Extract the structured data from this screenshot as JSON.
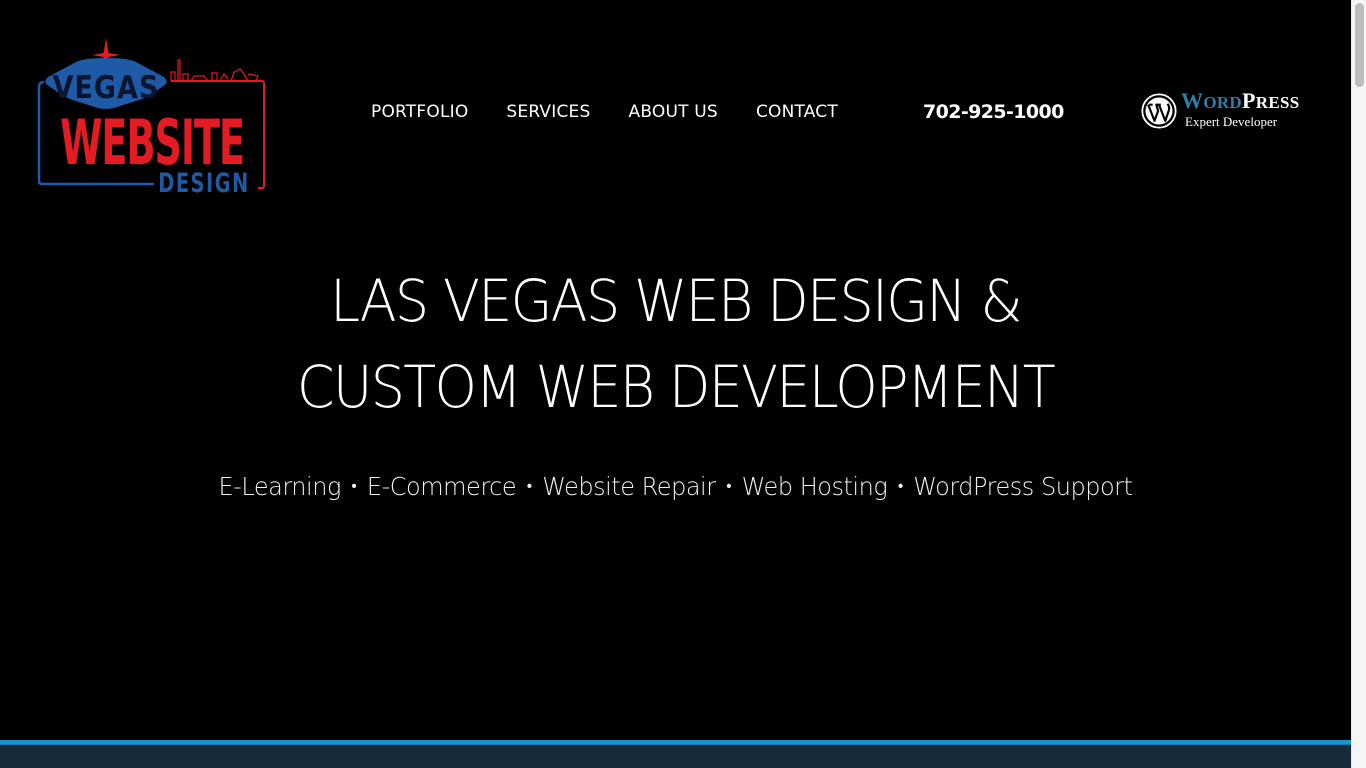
{
  "brand": {
    "logo_line1": "VEGAS",
    "logo_line2": "WEBSITE",
    "logo_line3": "DESIGN",
    "colors": {
      "red": "#e31b23",
      "blue": "#1e5aa6",
      "accent": "#1a94cd",
      "footer_band": "#172a38"
    }
  },
  "nav": {
    "items": [
      {
        "label": "PORTFOLIO"
      },
      {
        "label": "SERVICES"
      },
      {
        "label": "ABOUT US"
      },
      {
        "label": "CONTACT"
      }
    ],
    "phone": "702-925-1000"
  },
  "badge": {
    "icon": "wordpress-icon",
    "title_first": "W",
    "title_first_rest": "ORD",
    "title_second": "P",
    "title_second_rest": "RESS",
    "subtitle": "Expert Developer"
  },
  "hero": {
    "title_line1": "LAS VEGAS WEB DESIGN &",
    "title_line2": "CUSTOM WEB DEVELOPMENT",
    "services": [
      "E-Learning",
      "E-Commerce",
      "Website Repair",
      "Web Hosting",
      "WordPress Support"
    ],
    "separator": "•"
  }
}
